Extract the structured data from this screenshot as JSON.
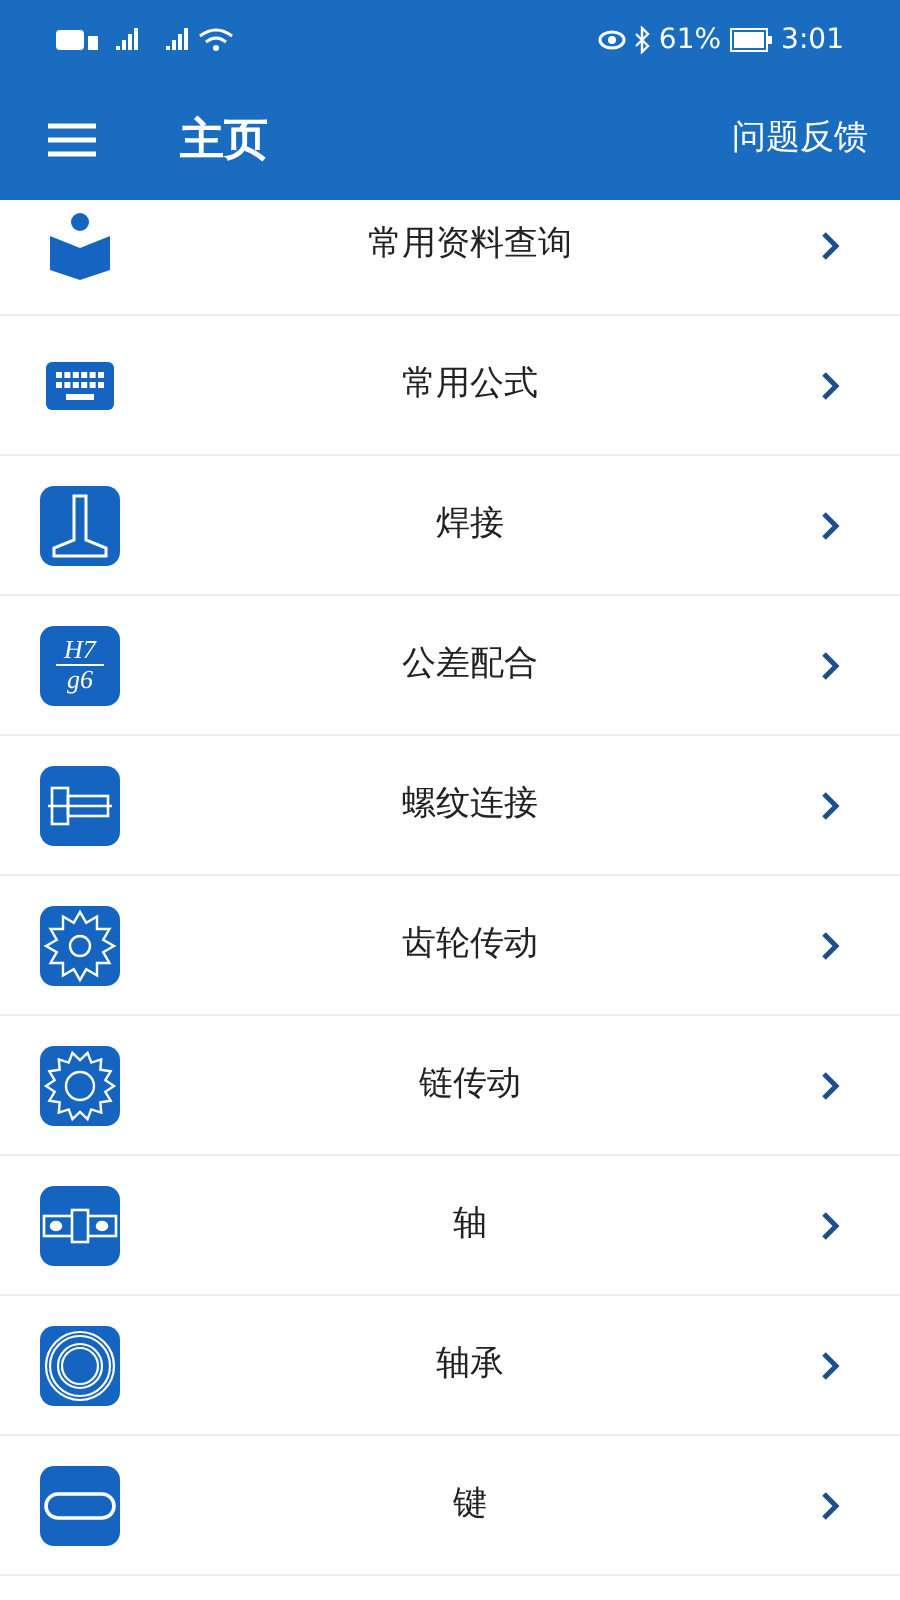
{
  "status_bar": {
    "battery": "61%",
    "time": "3:01"
  },
  "header": {
    "title": "主页",
    "action": "问题反馈"
  },
  "items": [
    {
      "label": "常用资料查询",
      "kind": "book"
    },
    {
      "label": "常用公式",
      "kind": "keyboard"
    },
    {
      "label": "焊接",
      "kind": "weld"
    },
    {
      "label": "公差配合",
      "kind": "fit",
      "icon_top": "H7",
      "icon_bottom": "g6"
    },
    {
      "label": "螺纹连接",
      "kind": "bolt"
    },
    {
      "label": "齿轮传动",
      "kind": "gear"
    },
    {
      "label": "链传动",
      "kind": "sprocket"
    },
    {
      "label": "轴",
      "kind": "shaft"
    },
    {
      "label": "轴承",
      "kind": "bearing"
    },
    {
      "label": "键",
      "kind": "key"
    }
  ]
}
